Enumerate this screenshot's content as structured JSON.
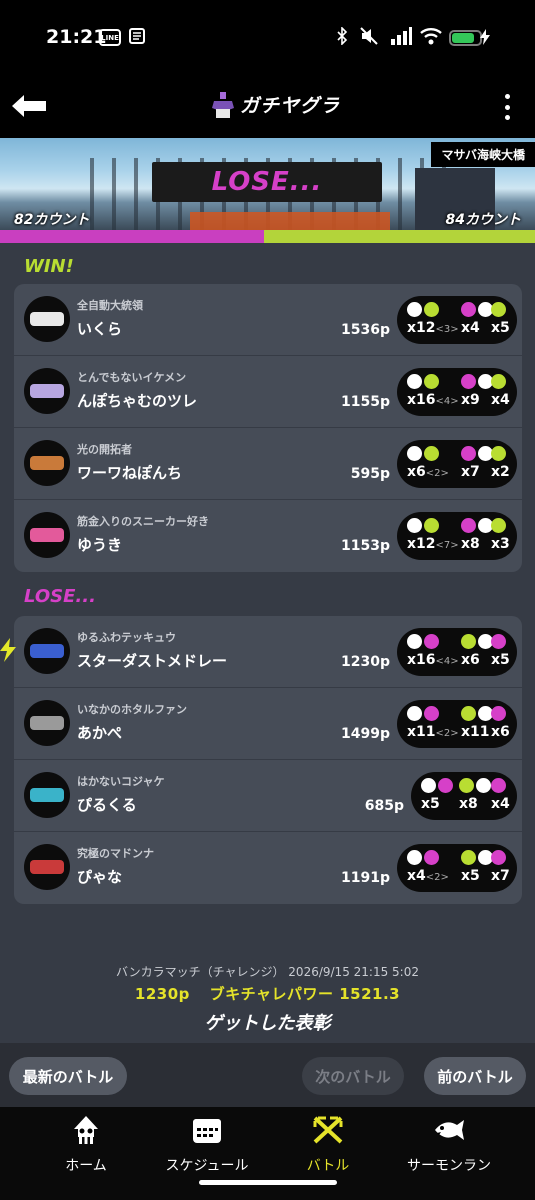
{
  "status_bar": {
    "time": "21:21",
    "line_badge": "LINE",
    "battery_level": 0.75
  },
  "header": {
    "title": "ガチヤグラ"
  },
  "stage": {
    "result": "LOSE...",
    "name": "マサバ海峡大橋",
    "our_count": "82カウント",
    "enemy_count": "84カウント",
    "our_share": 0.494
  },
  "win_team": {
    "label": "WIN!",
    "players": [
      {
        "byname": "全自動大統領",
        "name": "いくら",
        "points": "1536p",
        "kills": "x12",
        "assist": "<3>",
        "specials": "x4",
        "special_count": "x5",
        "weapon_color": "#e8e8e8",
        "special_color": "#b9dd32"
      },
      {
        "byname": "とんでもないイケメン",
        "name": "んぽちゃむのツレ",
        "points": "1155p",
        "kills": "x16",
        "assist": "<4>",
        "specials": "x9",
        "special_count": "x4",
        "weapon_color": "#b7a6e0",
        "special_color": "#b9dd32"
      },
      {
        "byname": "光の開拓者",
        "name": "ワーワねぽんち",
        "points": "595p",
        "kills": "x6",
        "assist": "<2>",
        "specials": "x7",
        "special_count": "x2",
        "weapon_color": "#c97a3a",
        "special_color": "#b9dd32"
      },
      {
        "byname": "筋金入りのスニーカー好き",
        "name": "ゆうき",
        "points": "1153p",
        "kills": "x12",
        "assist": "<7>",
        "specials": "x8",
        "special_count": "x3",
        "weapon_color": "#e35a9b",
        "special_color": "#b9dd32"
      }
    ]
  },
  "lose_team": {
    "label": "LOSE...",
    "players": [
      {
        "byname": "ゆるふわテッキュウ",
        "name": "スターダストメドレー",
        "points": "1230p",
        "kills": "x16",
        "assist": "<4>",
        "specials": "x6",
        "special_count": "x5",
        "weapon_color": "#3a5fd0",
        "special_color": "#d640c8"
      },
      {
        "byname": "いなかのホタルファン",
        "name": "あかぺ",
        "points": "1499p",
        "kills": "x11",
        "assist": "<2>",
        "specials": "x11",
        "special_count": "x6",
        "weapon_color": "#9a9a9a",
        "special_color": "#d640c8"
      },
      {
        "byname": "はかないコジャケ",
        "name": "ぴるくる",
        "points": "685p",
        "kills": "x5",
        "assist": "",
        "specials": "x8",
        "special_count": "x4",
        "weapon_color": "#3ab3c9",
        "special_color": "#d640c8"
      },
      {
        "byname": "究極のマドンナ",
        "name": "ぴゃな",
        "points": "1191p",
        "kills": "x4",
        "assist": "<2>",
        "specials": "x5",
        "special_count": "x7",
        "weapon_color": "#c93a3a",
        "special_color": "#d640c8"
      }
    ]
  },
  "summary": {
    "points": "1230p",
    "power": "ブキチャレパワー 1521.3",
    "meta": "バンカラマッチ（チャレンジ） 2026/9/15 21:15 5:02",
    "gear_title": "ゲットした表彰"
  },
  "nav_buttons": {
    "latest": "最新のバトル",
    "next": "次のバトル",
    "prev": "前のバトル"
  },
  "tabs": [
    {
      "label": "ホーム",
      "icon": "squid-icon"
    },
    {
      "label": "スケジュール",
      "icon": "calendar-icon"
    },
    {
      "label": "バトル",
      "icon": "battle-icon"
    },
    {
      "label": "サーモンラン",
      "icon": "salmon-icon"
    }
  ],
  "colors": {
    "win": "#b9dd32",
    "lose": "#d640c8",
    "accent_yellow": "#e5e32a"
  }
}
